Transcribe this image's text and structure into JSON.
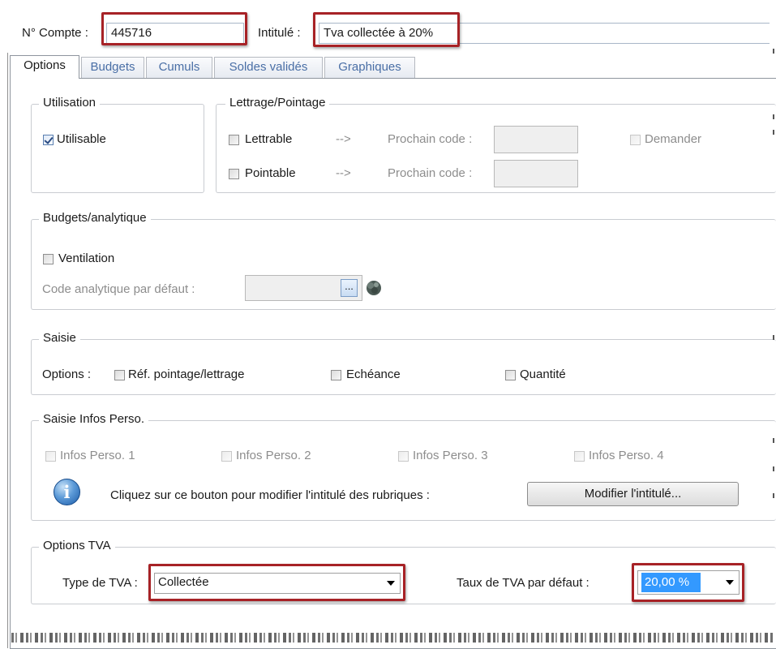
{
  "header": {
    "account_label": "N° Compte :",
    "account_value": "445716",
    "title_label": "Intitulé :",
    "title_value": "Tva collectée à 20%"
  },
  "tabs": [
    {
      "label": "Options",
      "active": true
    },
    {
      "label": "Budgets",
      "active": false
    },
    {
      "label": "Cumuls",
      "active": false
    },
    {
      "label": "Soldes validés",
      "active": false
    },
    {
      "label": "Graphiques",
      "active": false
    }
  ],
  "utilisation": {
    "title": "Utilisation",
    "usable_label": "Utilisable",
    "usable_checked": true
  },
  "lettrage": {
    "title": "Lettrage/Pointage",
    "lettrable_label": "Lettrable",
    "pointable_label": "Pointable",
    "arrow": "-->",
    "next_code_label": "Prochain code :",
    "ask_label": "Demander"
  },
  "budgets": {
    "title": "Budgets/analytique",
    "ventilation_label": "Ventilation",
    "code_label": "Code analytique par défaut :",
    "browse_label": "..."
  },
  "saisie": {
    "title": "Saisie",
    "options_label": "Options :",
    "ref_label": "Réf. pointage/lettrage",
    "echeance_label": "Echéance",
    "quantite_label": "Quantité"
  },
  "infos": {
    "title": "Saisie Infos Perso.",
    "items": [
      "Infos Perso. 1",
      "Infos Perso. 2",
      "Infos Perso. 3",
      "Infos Perso. 4"
    ],
    "hint": "Cliquez sur ce bouton pour modifier l'intitulé des rubriques :",
    "button_label": "Modifier l'intitulé...",
    "info_icon_glyph": "i"
  },
  "tva": {
    "title": "Options TVA",
    "type_label": "Type de TVA :",
    "type_value": "Collectée",
    "rate_label": "Taux de TVA par défaut :",
    "rate_value": "20,00 %"
  },
  "colors": {
    "highlight_border": "#a72226",
    "selection_bg": "#3399ff",
    "tab_text": "#4a6fa6"
  }
}
